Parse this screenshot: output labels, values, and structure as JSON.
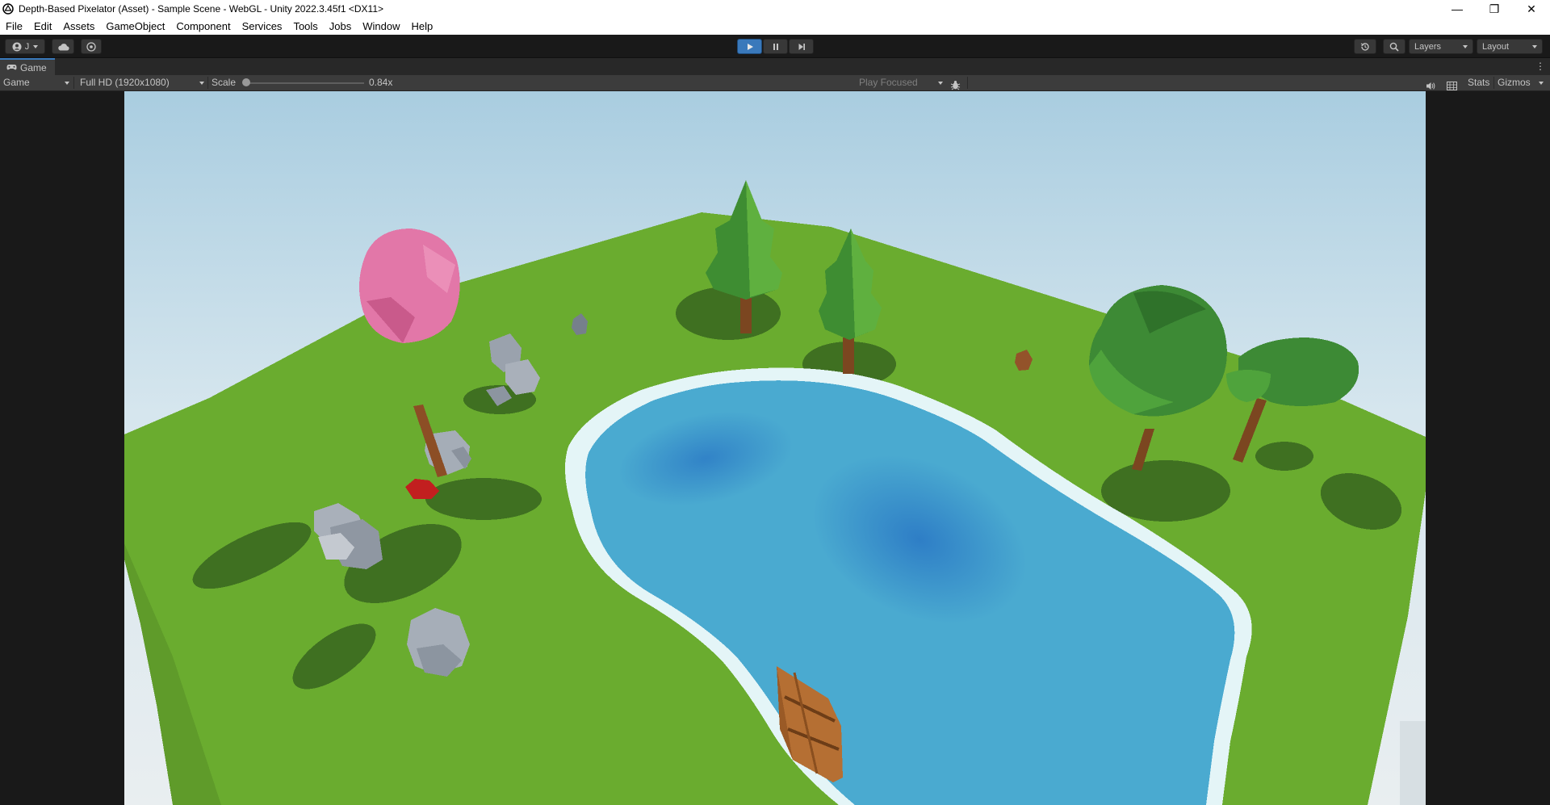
{
  "window": {
    "title": "Depth-Based Pixelator (Asset) - Sample Scene - WebGL - Unity 2022.3.45f1 <DX11>",
    "minimize_glyph": "—",
    "restore_glyph": "❐",
    "close_glyph": "✕"
  },
  "menu": {
    "items": [
      "File",
      "Edit",
      "Assets",
      "GameObject",
      "Component",
      "Services",
      "Tools",
      "Jobs",
      "Window",
      "Help"
    ]
  },
  "toolbar": {
    "account_label": "J",
    "layers_label": "Layers",
    "layout_label": "Layout",
    "icons": [
      "account-icon",
      "cloud-icon",
      "collab-icon",
      "play-icon",
      "pause-icon",
      "step-icon",
      "history-icon",
      "search-icon"
    ]
  },
  "game_tab": {
    "label": "Game",
    "menu_glyph": "⋮"
  },
  "game_toolbar": {
    "view_select": "Game",
    "resolution": "Full HD (1920x1080)",
    "scale_label": "Scale",
    "scale_value": "0.84x",
    "play_mode": "Play Focused",
    "stats_label": "Stats",
    "gizmos_label": "Gizmos"
  },
  "colors": {
    "accent": "#3a79bb",
    "editor_bg": "#191919",
    "panel": "#3c3c3c",
    "sky_top": "#a9cde0",
    "grass": "#6aac2f",
    "water": "#4aaad0",
    "water_deep": "#2b79c5",
    "foam": "#e4f5f7"
  }
}
